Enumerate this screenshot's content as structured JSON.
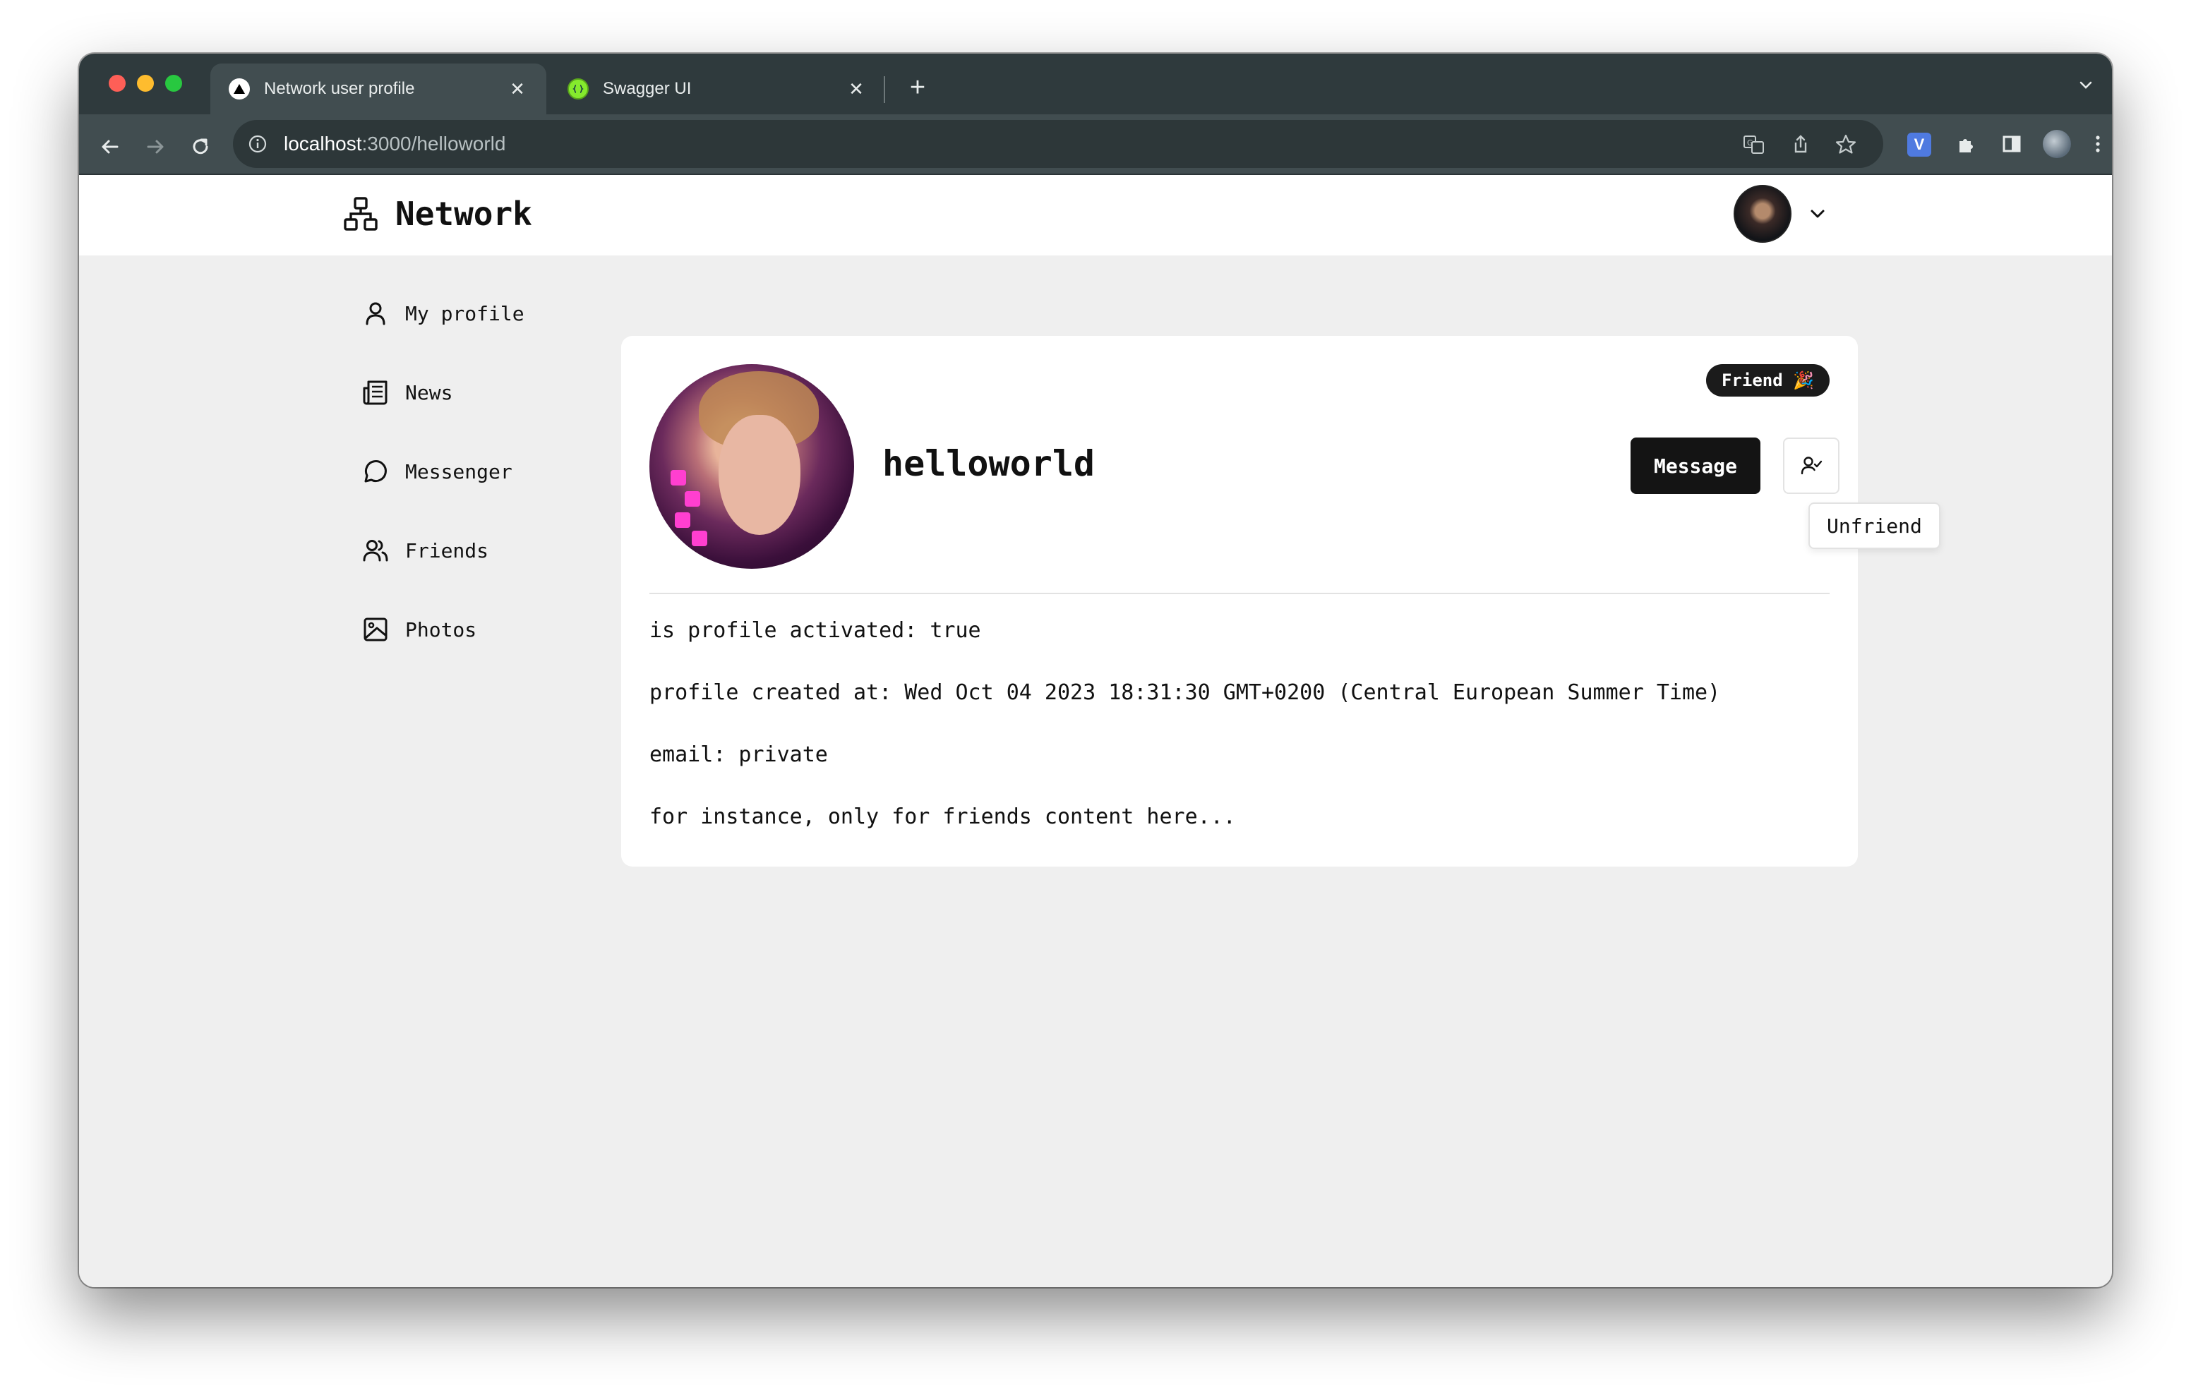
{
  "browser": {
    "tabs": [
      {
        "title": "Network user profile",
        "active": true,
        "close_label": "✕"
      },
      {
        "title": "Swagger UI",
        "active": false,
        "close_label": "✕"
      }
    ],
    "new_tab_label": "+",
    "url_host": "localhost",
    "url_path": ":3000/helloworld",
    "colors": {
      "frame": "#2f3a3d",
      "toolbar": "#414d50",
      "omnibox": "#2d3739"
    },
    "extension_label": "V"
  },
  "app": {
    "brand": "Network",
    "brand_icon": "sitemap-icon"
  },
  "sidebar": {
    "items": [
      {
        "label": "My profile",
        "icon": "user-icon"
      },
      {
        "label": "News",
        "icon": "newspaper-icon"
      },
      {
        "label": "Messenger",
        "icon": "chat-bubble-icon"
      },
      {
        "label": "Friends",
        "icon": "users-icon"
      },
      {
        "label": "Photos",
        "icon": "image-icon"
      }
    ]
  },
  "profile": {
    "badge": "Friend 🎉",
    "username": "helloworld",
    "message_button": "Message",
    "unfriend_tooltip": "Unfriend",
    "details": [
      "is profile activated: true",
      "profile created at: Wed Oct 04 2023 18:31:30 GMT+0200 (Central European Summer Time)",
      "email: private",
      "for instance, only for friends content here..."
    ]
  }
}
